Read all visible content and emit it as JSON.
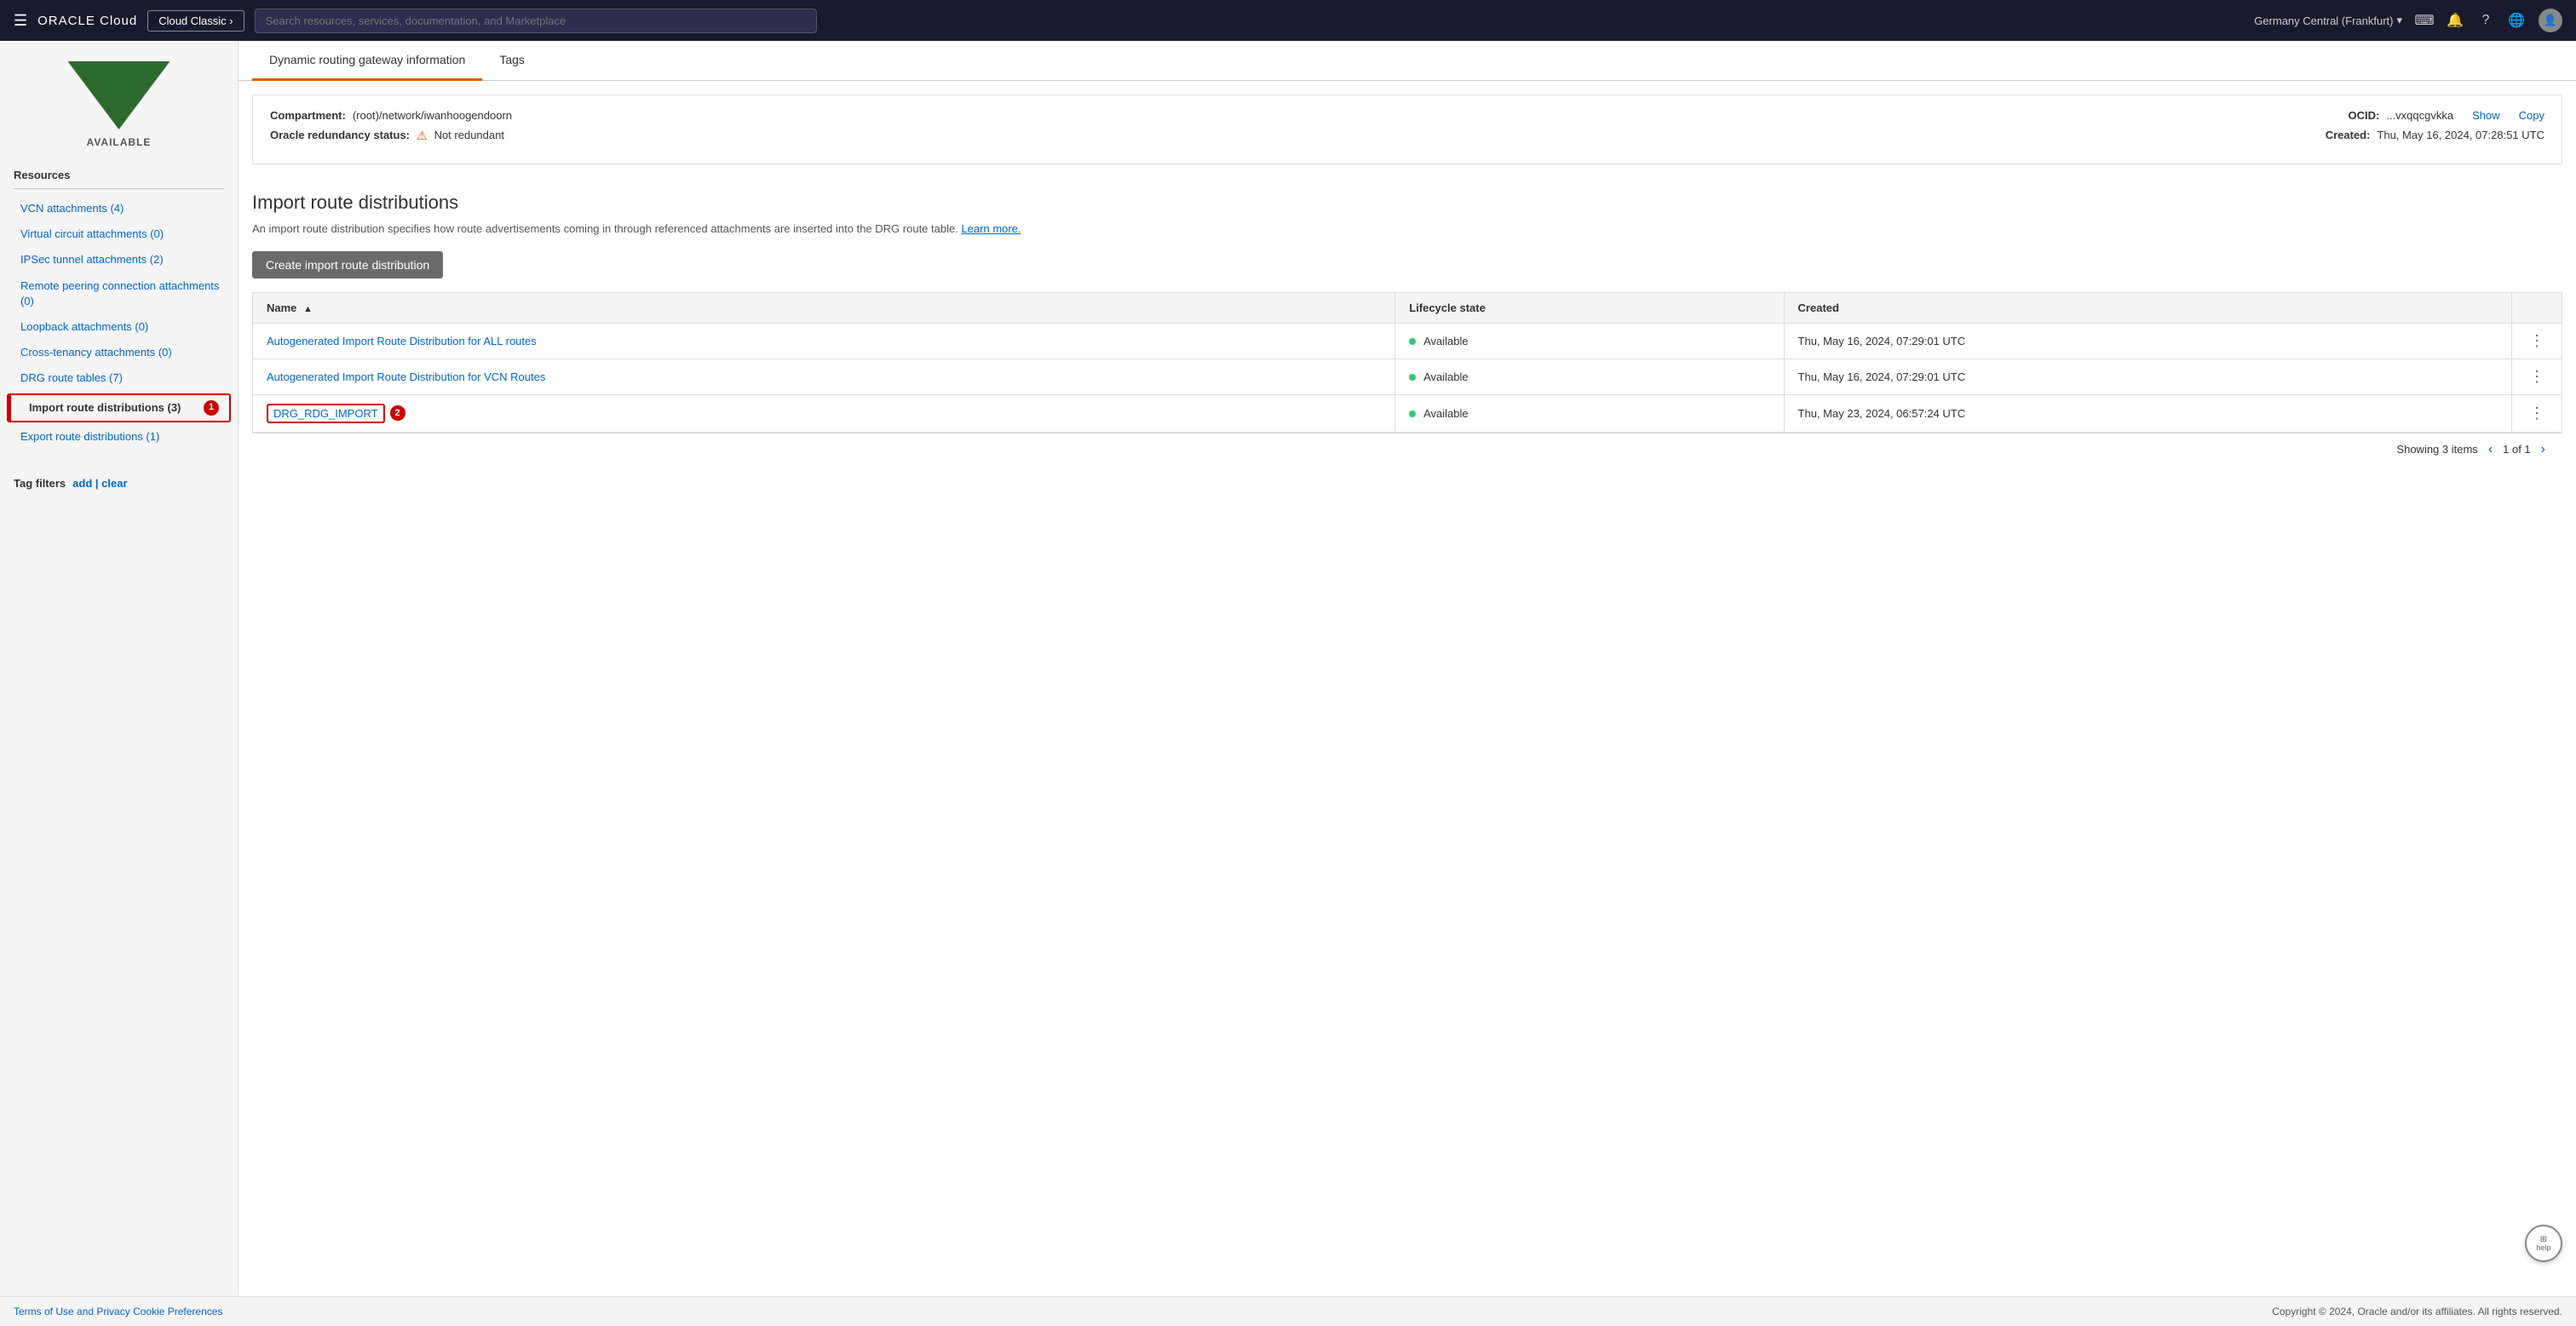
{
  "topnav": {
    "hamburger": "☰",
    "oracle_logo": "ORACLE Cloud",
    "cloud_classic_btn": "Cloud Classic ›",
    "search_placeholder": "Search resources, services, documentation, and Marketplace",
    "region": "Germany Central (Frankfurt)",
    "region_chevron": "▾",
    "icons": {
      "terminal": "⌨",
      "bell": "🔔",
      "help": "?",
      "globe": "🌐"
    }
  },
  "sidebar": {
    "status": "AVAILABLE",
    "resources_title": "Resources",
    "items": [
      {
        "id": "vcn-attachments",
        "label": "VCN attachments (4)",
        "active": false
      },
      {
        "id": "virtual-circuit-attachments",
        "label": "Virtual circuit attachments (0)",
        "active": false
      },
      {
        "id": "ipsec-tunnel-attachments",
        "label": "IPSec tunnel attachments (2)",
        "active": false
      },
      {
        "id": "remote-peering",
        "label": "Remote peering connection attachments (0)",
        "active": false
      },
      {
        "id": "loopback-attachments",
        "label": "Loopback attachments (0)",
        "active": false
      },
      {
        "id": "cross-tenancy-attachments",
        "label": "Cross-tenancy attachments (0)",
        "active": false
      },
      {
        "id": "drg-route-tables",
        "label": "DRG route tables (7)",
        "active": false
      },
      {
        "id": "import-route-distributions",
        "label": "Import route distributions (3)",
        "active": true,
        "badge": "1"
      },
      {
        "id": "export-route-distributions",
        "label": "Export route distributions (1)",
        "active": false
      }
    ],
    "tag_filters": {
      "title": "Tag filters",
      "add_link": "add",
      "separator": "|",
      "clear_link": "clear"
    }
  },
  "tabs": [
    {
      "id": "drg-info",
      "label": "Dynamic routing gateway information",
      "active": true
    },
    {
      "id": "tags",
      "label": "Tags",
      "active": false
    }
  ],
  "info_panel": {
    "compartment_label": "Compartment:",
    "compartment_value": "(root)/network/iwanhoogendoorn",
    "ocid_label": "OCID:",
    "ocid_value": "...vxqqcgvkka",
    "show_link": "Show",
    "copy_link": "Copy",
    "redundancy_label": "Oracle redundancy status:",
    "redundancy_warning": "⚠",
    "redundancy_value": "Not redundant",
    "created_label": "Created:",
    "created_value": "Thu, May 16, 2024, 07:28:51 UTC"
  },
  "route_distributions": {
    "title": "Import route distributions",
    "description": "An import route distribution specifies how route advertisements coming in through referenced attachments are inserted into the DRG route table.",
    "learn_more": "Learn more.",
    "create_btn": "Create import route distribution",
    "table": {
      "columns": [
        {
          "id": "name",
          "label": "Name",
          "sortable": true,
          "sort_dir": "asc"
        },
        {
          "id": "lifecycle-state",
          "label": "Lifecycle state",
          "sortable": false
        },
        {
          "id": "created",
          "label": "Created",
          "sortable": false
        }
      ],
      "rows": [
        {
          "name": "Autogenerated Import Route Distribution for ALL routes",
          "lifecycle": "Available",
          "created": "Thu, May 16, 2024, 07:29:01 UTC",
          "highlighted": false,
          "badge": null
        },
        {
          "name": "Autogenerated Import Route Distribution for VCN Routes",
          "lifecycle": "Available",
          "created": "Thu, May 16, 2024, 07:29:01 UTC",
          "highlighted": false,
          "badge": null
        },
        {
          "name": "DRG_RDG_IMPORT",
          "lifecycle": "Available",
          "created": "Thu, May 23, 2024, 06:57:24 UTC",
          "highlighted": true,
          "badge": "2"
        }
      ],
      "showing": "Showing 3 items",
      "pagination": "1 of 1"
    }
  },
  "footer": {
    "terms": "Terms of Use and Privacy",
    "cookies": "Cookie Preferences",
    "copyright": "Copyright © 2024, Oracle and/or its affiliates. All rights reserved."
  }
}
